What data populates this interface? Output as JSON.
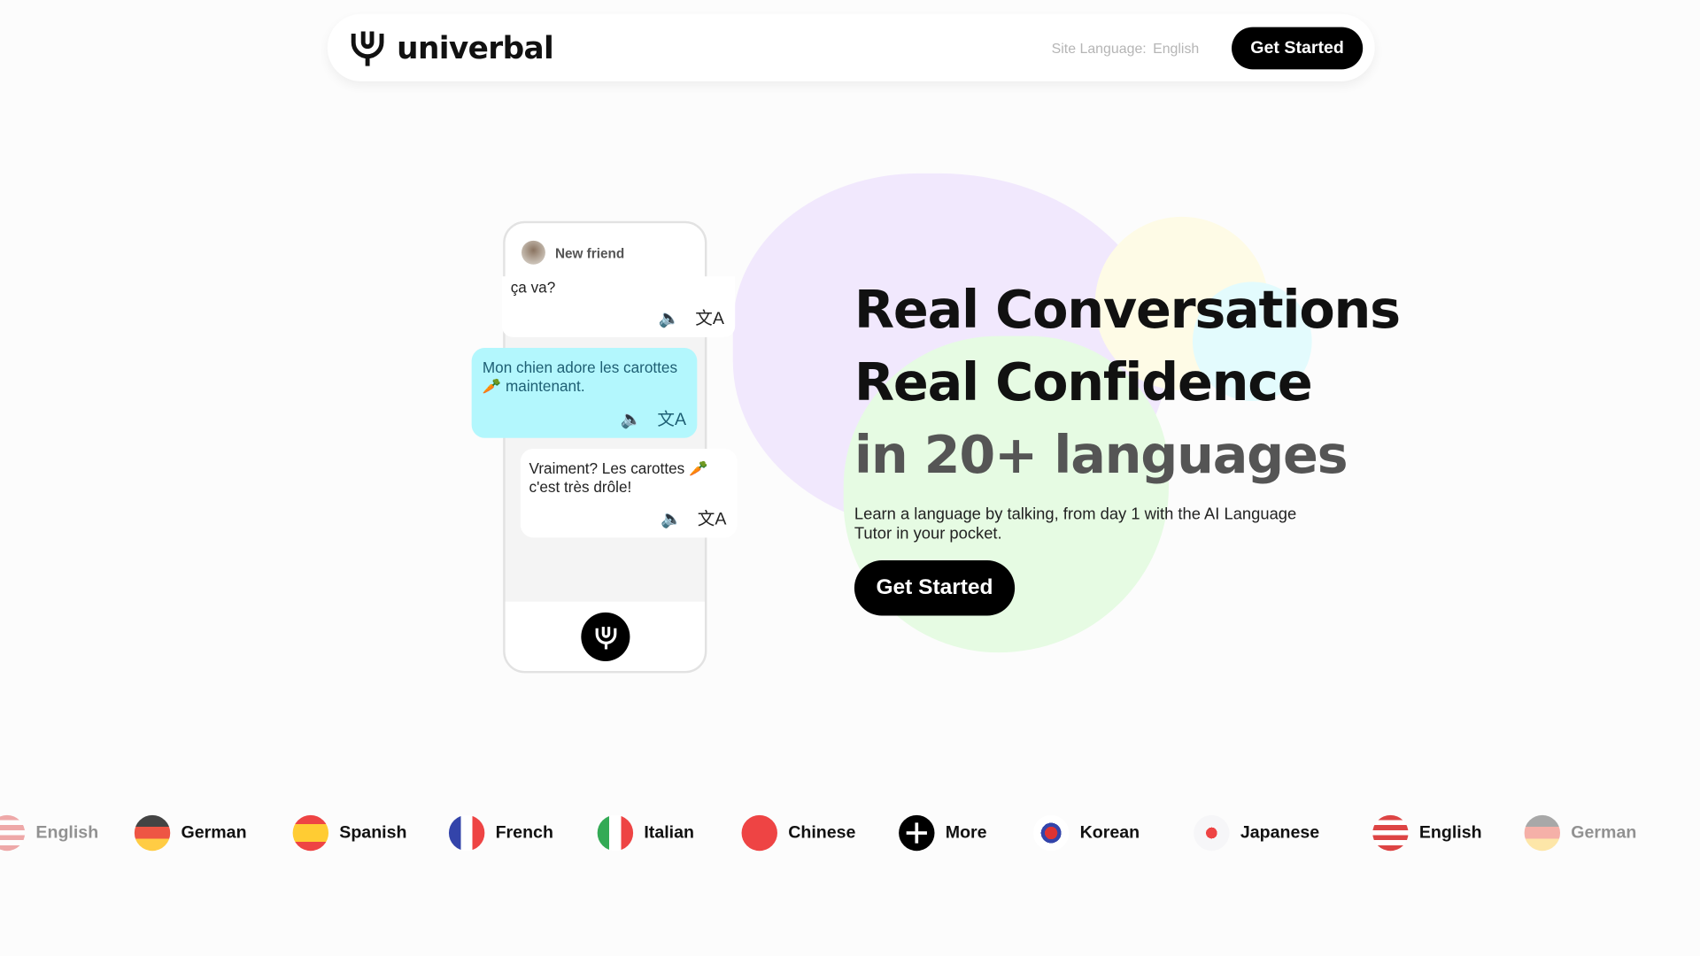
{
  "nav": {
    "brand": "univerbal",
    "site_language_label": "Site Language:",
    "site_language_value": "English",
    "cta": "Get Started"
  },
  "phone": {
    "contact": "New friend",
    "messages": [
      {
        "text": "ça va?",
        "from": "friend"
      },
      {
        "text": "Mon chien adore les carottes 🥕 maintenant.",
        "from": "user"
      },
      {
        "text": "Vraiment? Les carottes 🥕 c'est très drôle!",
        "from": "friend"
      }
    ],
    "icons": [
      "speaker-icon",
      "translate-icon"
    ]
  },
  "hero": {
    "line1": "Real Conversations",
    "line2": "Real Confidence",
    "line3": "in 20+ languages",
    "subtitle": "Learn a language by talking, from day 1 with the AI Language Tutor in your pocket.",
    "cta": "Get Started"
  },
  "languages": [
    "English",
    "German",
    "Spanish",
    "French",
    "Italian",
    "Chinese",
    "More",
    "Korean",
    "Japanese",
    "English",
    "German"
  ],
  "colors": {
    "user_bubble": "#b3f7fd",
    "user_text": "#1e5f74",
    "accent": "#000000"
  }
}
